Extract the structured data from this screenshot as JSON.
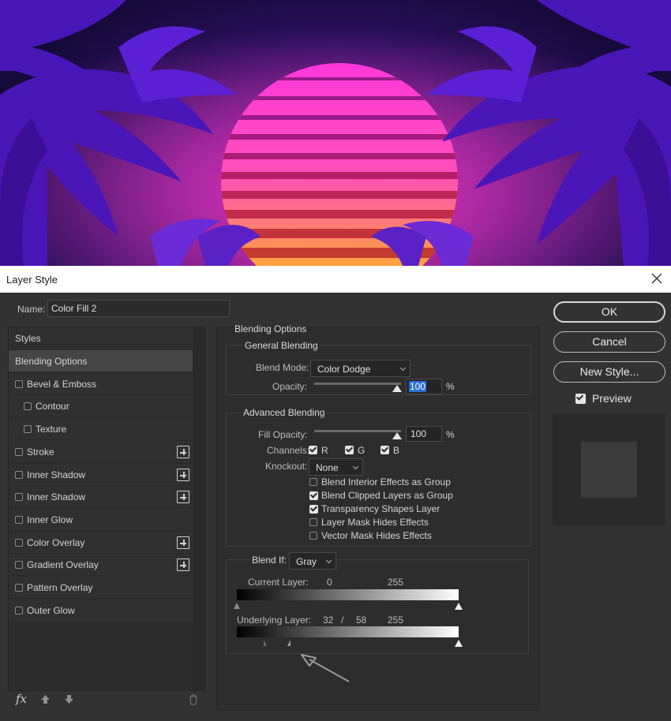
{
  "dialog": {
    "title": "Layer Style",
    "name_label": "Name:",
    "name_value": "Color Fill 2"
  },
  "styles_list": {
    "header": "Styles",
    "items": [
      {
        "label": "Blending Options",
        "selected": true,
        "checkbox": false,
        "plus": false,
        "indent": false
      },
      {
        "label": "Bevel & Emboss",
        "checkbox": true,
        "plus": false,
        "indent": false
      },
      {
        "label": "Contour",
        "checkbox": true,
        "plus": false,
        "indent": true
      },
      {
        "label": "Texture",
        "checkbox": true,
        "plus": false,
        "indent": true
      },
      {
        "label": "Stroke",
        "checkbox": true,
        "plus": true,
        "indent": false
      },
      {
        "label": "Inner Shadow",
        "checkbox": true,
        "plus": true,
        "indent": false
      },
      {
        "label": "Inner Shadow",
        "checkbox": true,
        "plus": true,
        "indent": false
      },
      {
        "label": "Inner Glow",
        "checkbox": true,
        "plus": false,
        "indent": false
      },
      {
        "label": "Color Overlay",
        "checkbox": true,
        "plus": true,
        "indent": false
      },
      {
        "label": "Gradient Overlay",
        "checkbox": true,
        "plus": true,
        "indent": false
      },
      {
        "label": "Pattern Overlay",
        "checkbox": true,
        "plus": false,
        "indent": false
      },
      {
        "label": "Outer Glow",
        "checkbox": true,
        "plus": false,
        "indent": false
      }
    ],
    "footer_fx": "fx"
  },
  "blending": {
    "section_title": "Blending Options",
    "general_title": "General Blending",
    "blend_mode_label": "Blend Mode:",
    "blend_mode_value": "Color Dodge",
    "opacity_label": "Opacity:",
    "opacity_value": "100",
    "percent": "%",
    "advanced_title": "Advanced Blending",
    "fill_opacity_label": "Fill Opacity:",
    "fill_opacity_value": "100",
    "channels_label": "Channels:",
    "channel_r": "R",
    "channel_g": "G",
    "channel_b": "B",
    "knockout_label": "Knockout:",
    "knockout_value": "None",
    "options": [
      {
        "label": "Blend Interior Effects as Group",
        "checked": false
      },
      {
        "label": "Blend Clipped Layers as Group",
        "checked": true
      },
      {
        "label": "Transparency Shapes Layer",
        "checked": true
      },
      {
        "label": "Layer Mask Hides Effects",
        "checked": false
      },
      {
        "label": "Vector Mask Hides Effects",
        "checked": false
      }
    ],
    "blend_if_label": "Blend If:",
    "blend_if_value": "Gray",
    "current_layer_label": "Current Layer:",
    "current_min": "0",
    "current_max": "255",
    "underlying_layer_label": "Underlying Layer:",
    "underlying_min_a": "32",
    "underlying_slash": "/",
    "underlying_min_b": "58",
    "underlying_max": "255"
  },
  "buttons": {
    "ok": "OK",
    "cancel": "Cancel",
    "new_style": "New Style...",
    "preview_label": "Preview"
  },
  "colors": {
    "sun_top": "#ff3ad6",
    "sun_bottom": "#ffa23a",
    "sky": "#1e0b4a",
    "palm": "#5a1fd0"
  }
}
